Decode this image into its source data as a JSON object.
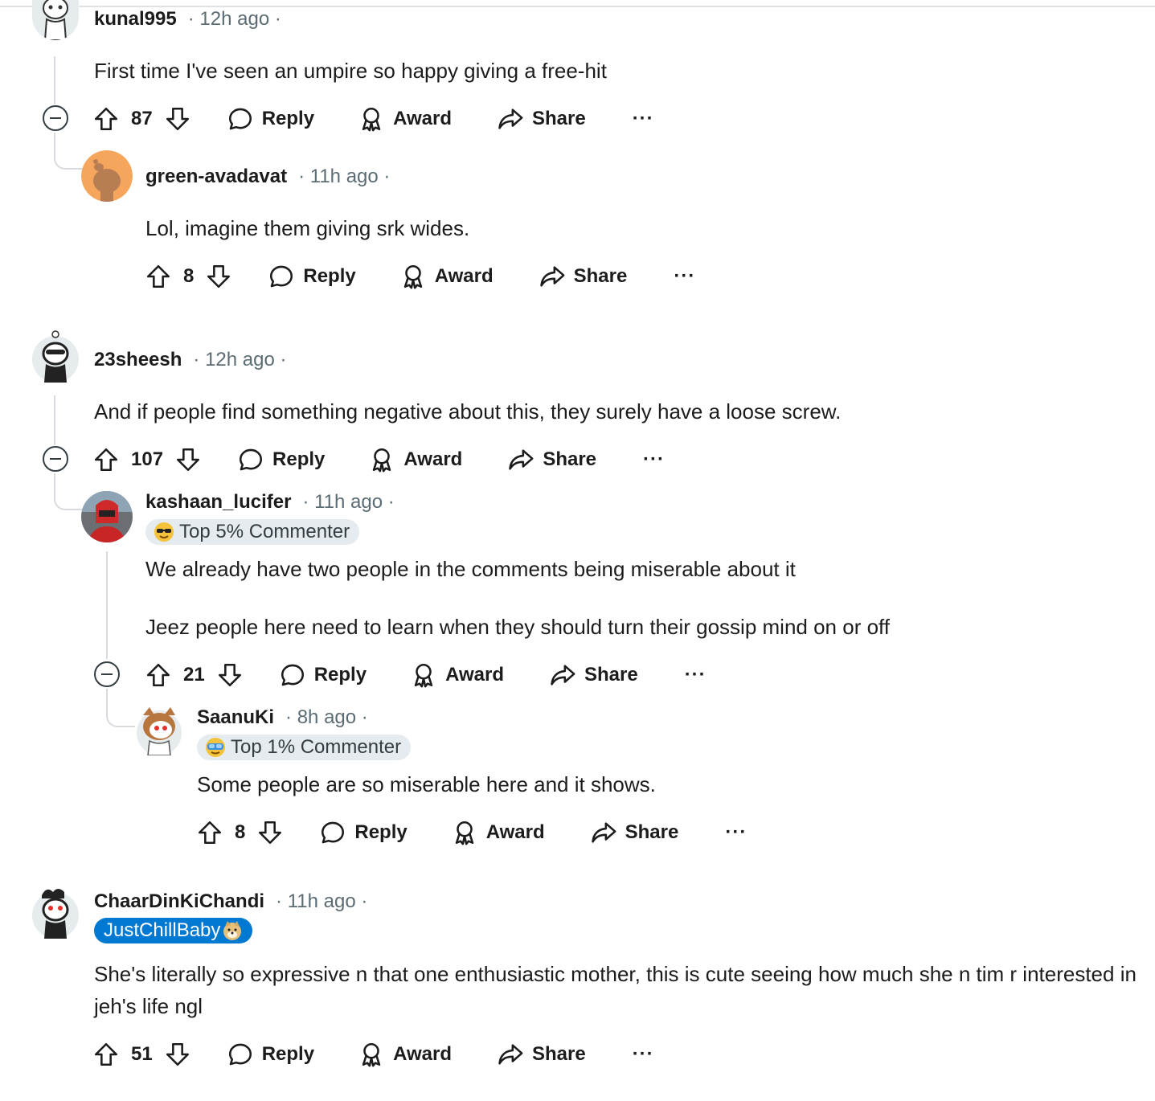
{
  "comments": [
    {
      "author": "kunal995",
      "time": "12h ago",
      "body": "First time I've seen an umpire so happy giving a free-hit",
      "score": "87",
      "reply_label": "Reply",
      "award_label": "Award",
      "share_label": "Share",
      "more_label": "···"
    },
    {
      "author": "green-avadavat",
      "time": "11h ago",
      "body": "Lol, imagine them giving srk wides.",
      "score": "8",
      "reply_label": "Reply",
      "award_label": "Award",
      "share_label": "Share",
      "more_label": "···"
    },
    {
      "author": "23sheesh",
      "time": "12h ago",
      "body": "And if people find something negative about this, they surely have a loose screw.",
      "score": "107",
      "reply_label": "Reply",
      "award_label": "Award",
      "share_label": "Share",
      "more_label": "···"
    },
    {
      "author": "kashaan_lucifer",
      "time": "11h ago",
      "flair": "Top 5% Commenter",
      "body_line1": "We already have two people in the comments being miserable about it",
      "body_line2": "Jeez people here need to learn when they should turn their gossip mind on or off",
      "score": "21",
      "reply_label": "Reply",
      "award_label": "Award",
      "share_label": "Share",
      "more_label": "···"
    },
    {
      "author": "SaanuKi",
      "time": "8h ago",
      "flair": "Top 1% Commenter",
      "body": "Some people are so miserable here and it shows.",
      "score": "8",
      "reply_label": "Reply",
      "award_label": "Award",
      "share_label": "Share",
      "more_label": "···"
    },
    {
      "author": "ChaarDinKiChandi",
      "time": "11h ago",
      "flair": "JustChillBaby",
      "body": "She's literally so expressive n that one enthusiastic mother, this is cute seeing how much she n tim r interested in jeh's life ngl",
      "score": "51",
      "reply_label": "Reply",
      "award_label": "Award",
      "share_label": "Share",
      "more_label": "···"
    }
  ],
  "icons": {
    "upvote": "upvote-icon",
    "downvote": "downvote-icon",
    "reply": "comment-bubble-icon",
    "award": "award-icon",
    "share": "share-arrow-icon",
    "collapse": "collapse-minus-icon",
    "more": "more-options-icon"
  },
  "colors": {
    "text": "#1c1c1c",
    "meta": "#5c6c74",
    "thread_line": "#d7dbdf",
    "flair_bg": "#e5ebee",
    "user_flair_bg": "#0079d3"
  }
}
